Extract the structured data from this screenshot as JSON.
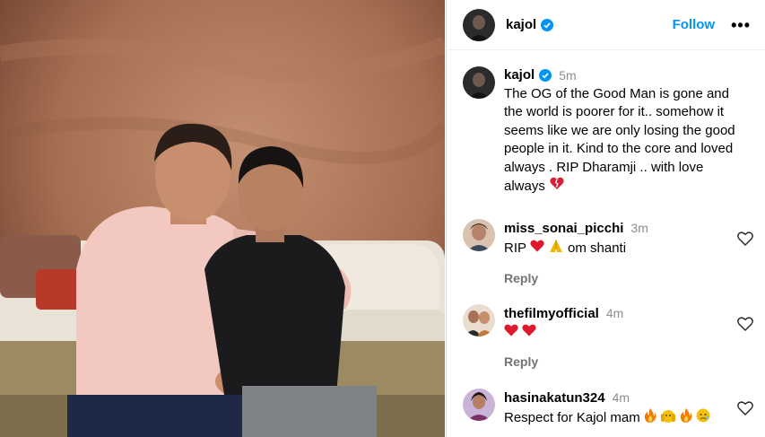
{
  "post": {
    "username": "kajol",
    "follow_label": "Follow",
    "more_label": "•••"
  },
  "caption": {
    "username": "kajol",
    "time": "5m",
    "lines": [
      "The OG of the Good Man is gone and",
      "the world is poorer for it.. somehow it",
      "seems like we are only losing the good",
      "people in it. Kind to the core and loved",
      "always . RIP Dharamji .. with love",
      "always"
    ]
  },
  "comments": [
    {
      "username": "miss_sonai_picchi",
      "time": "3m",
      "text_before": "RIP",
      "text_after": "om shanti",
      "reply": "Reply"
    },
    {
      "username": "thefilmyofficial",
      "time": "4m",
      "reply": "Reply"
    },
    {
      "username": "hasinakatun324",
      "time": "4m",
      "text": "Respect for Kajol mam"
    }
  ],
  "colors": {
    "accent": "#0095f6",
    "muted": "#8e8e8e",
    "heart": "#e0182d"
  }
}
